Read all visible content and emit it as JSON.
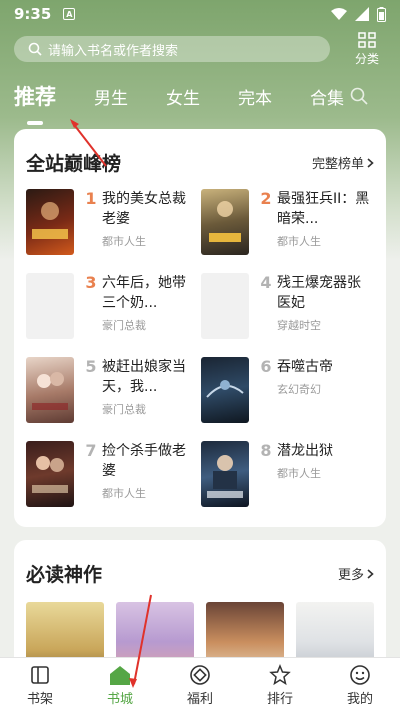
{
  "status": {
    "time": "9:35",
    "notification": "A"
  },
  "search": {
    "placeholder": "请输入书名或作者搜索"
  },
  "category": {
    "label": "分类"
  },
  "tabs": [
    {
      "label": "推荐",
      "active": true
    },
    {
      "label": "男生"
    },
    {
      "label": "女生"
    },
    {
      "label": "完本"
    },
    {
      "label": "合集"
    }
  ],
  "ranking": {
    "title": "全站巅峰榜",
    "more": "完整榜单",
    "books": [
      {
        "rank": "1",
        "title": "我的美女总裁老婆",
        "tag": "都市人生"
      },
      {
        "rank": "2",
        "title": "最强狂兵II：黑暗荣...",
        "tag": "都市人生"
      },
      {
        "rank": "3",
        "title": "六年后，她带三个奶...",
        "tag": "豪门总裁"
      },
      {
        "rank": "4",
        "title": "残王爆宠器张医妃",
        "tag": "穿越时空"
      },
      {
        "rank": "5",
        "title": "被赶出娘家当天，我...",
        "tag": "豪门总裁"
      },
      {
        "rank": "6",
        "title": "吞噬古帝",
        "tag": "玄幻奇幻"
      },
      {
        "rank": "7",
        "title": "捡个杀手做老婆",
        "tag": "都市人生"
      },
      {
        "rank": "8",
        "title": "潜龙出狱",
        "tag": "都市人生"
      }
    ]
  },
  "must_read": {
    "title": "必读神作",
    "more": "更多"
  },
  "nav": [
    {
      "label": "书架",
      "icon": "bookshelf-icon"
    },
    {
      "label": "书城",
      "icon": "bookstore-icon",
      "active": true
    },
    {
      "label": "福利",
      "icon": "welfare-icon"
    },
    {
      "label": "排行",
      "icon": "ranking-icon"
    },
    {
      "label": "我的",
      "icon": "profile-icon"
    }
  ],
  "colors": {
    "accent": "#55a645",
    "rank_top": "#e9814f",
    "header": "#7ea56d",
    "annotation": "#e0322b"
  }
}
